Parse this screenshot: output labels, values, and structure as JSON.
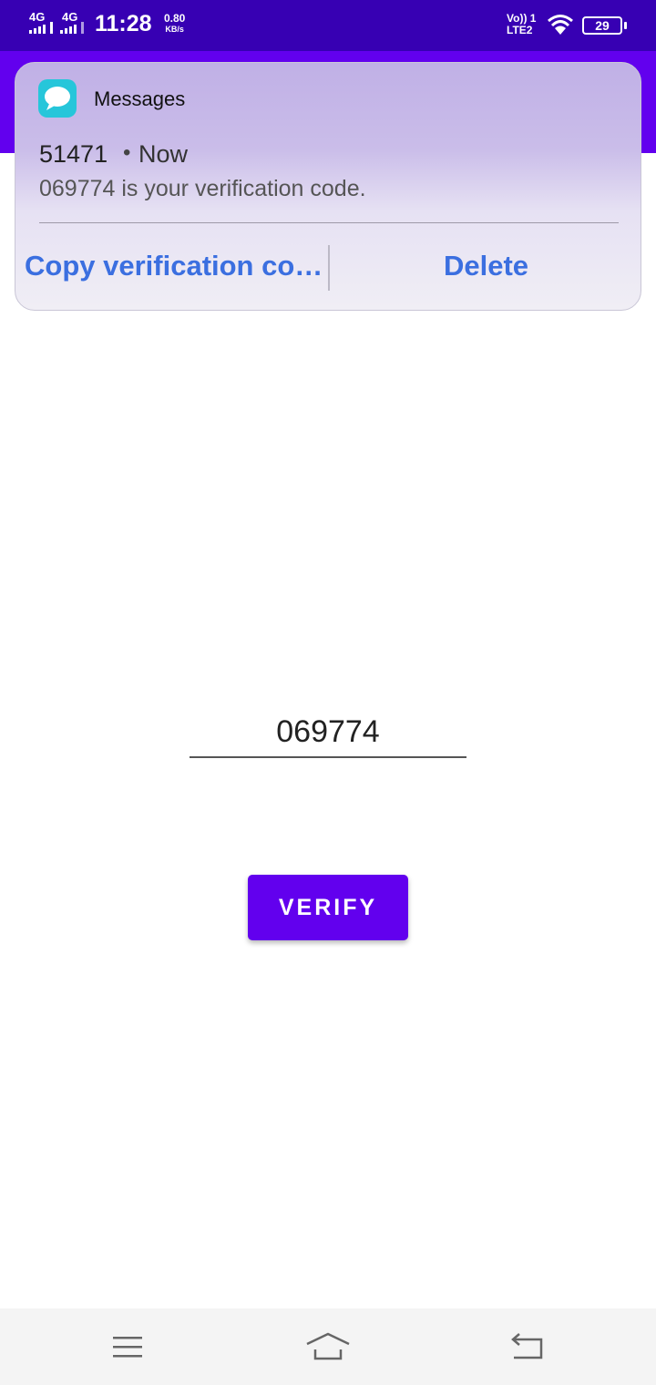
{
  "status_bar": {
    "network1": "4G",
    "network2": "4G",
    "time": "11:28",
    "speed_value": "0.80",
    "speed_unit": "KB/s",
    "volte_top": "Vo)) 1",
    "volte_bottom": "LTE2",
    "battery": "29"
  },
  "notification": {
    "app_name": "Messages",
    "sender": "51471",
    "separator": "•",
    "time": "Now",
    "body": "069774 is your verification code.",
    "action_copy": "Copy verification co…",
    "action_delete": "Delete",
    "app_icon": "message-bubble-icon",
    "icon_color": "#26c6da"
  },
  "form": {
    "code_value": "069774",
    "verify_label": "VERIFY"
  },
  "nav_bar": {
    "menu_icon": "menu-icon",
    "home_icon": "home-icon",
    "back_icon": "back-icon"
  },
  "colors": {
    "status_bar": "#3700b3",
    "primary": "#6200ee",
    "action_text": "#3b6fe0"
  }
}
